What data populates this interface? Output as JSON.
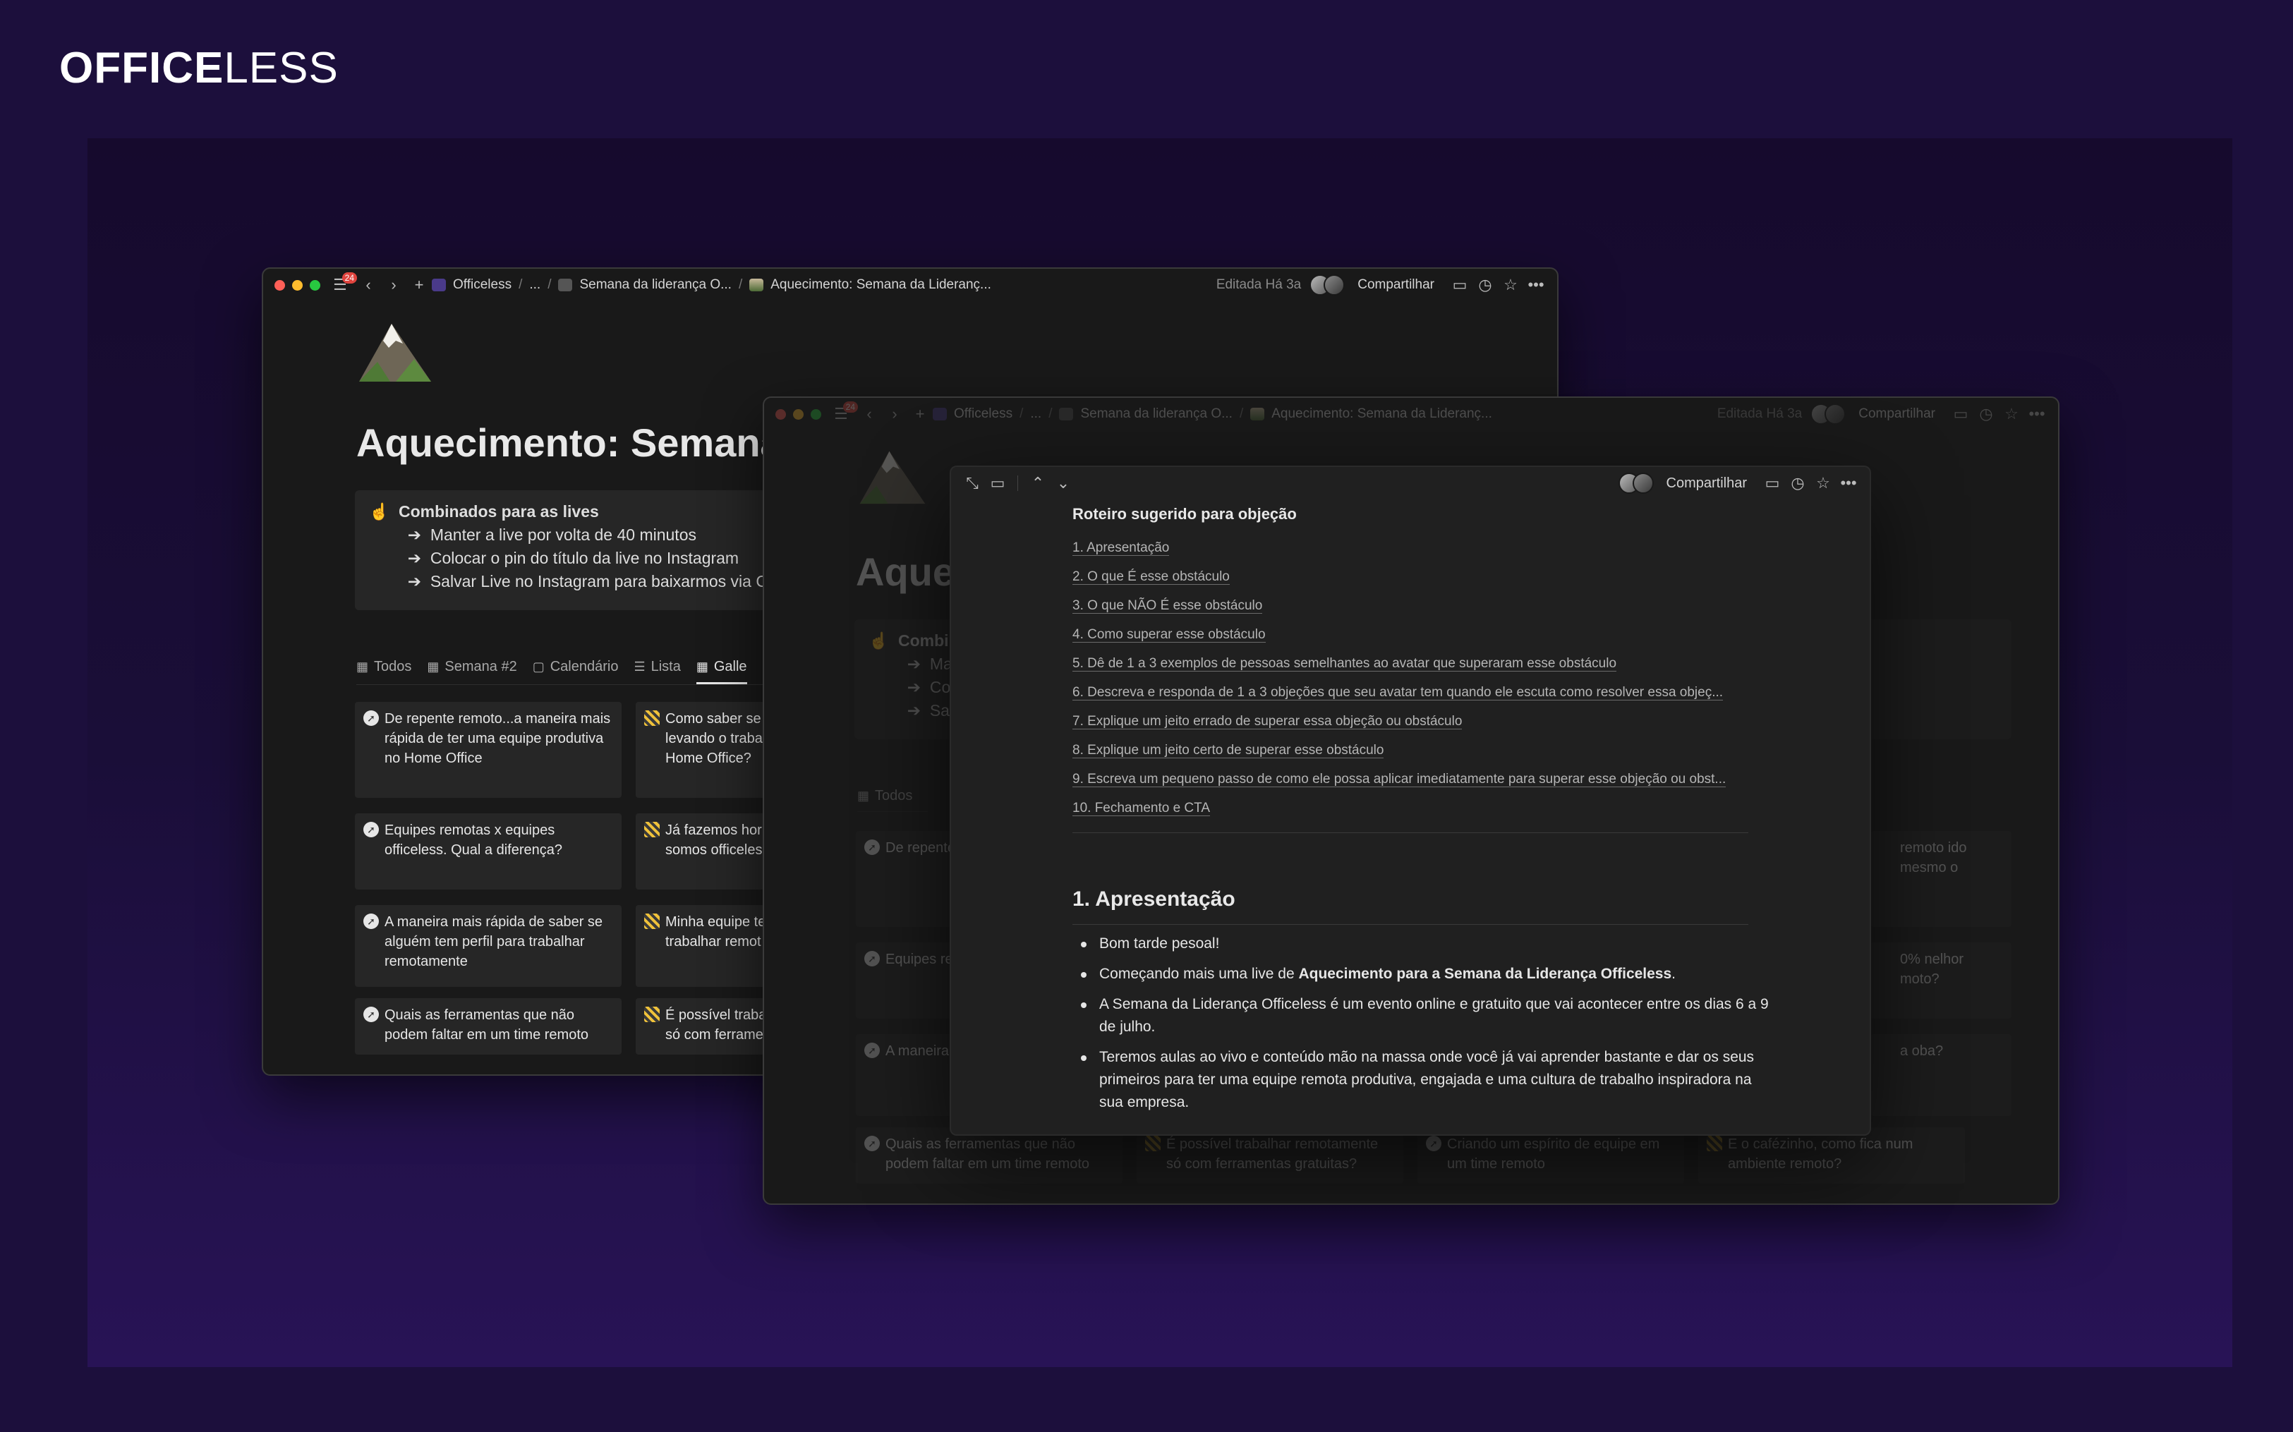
{
  "brand": {
    "logo_bold": "OFFICE",
    "logo_light": "LESS"
  },
  "back_window": {
    "badge_count": "24",
    "breadcrumb": [
      "Officeless",
      "...",
      "Semana da liderança O...",
      "Aquecimento: Semana da Lideranç..."
    ],
    "edited": "Editada Há 3a",
    "share_label": "Compartilhar",
    "title": "Aquecimento: Semana",
    "callout": {
      "heading": "Combinados para as lives",
      "items": [
        "Manter a live por volta de 40 minutos",
        "Colocar o pin do título da live no Instagram",
        "Salvar Live no Instagram para baixarmos via Chro"
      ]
    },
    "tabs": [
      "Todos",
      "Semana #2",
      "Calendário",
      "Lista",
      "Galle"
    ],
    "cards_col1": [
      "De repente remoto...a maneira mais rápida de ter uma equipe produtiva no Home Office",
      "Equipes remotas x equipes officeless. Qual a diferença?",
      "A maneira mais rápida de saber se alguém tem perfil para trabalhar remotamente",
      "Quais as ferramentas que não podem faltar em um time remoto"
    ],
    "cards_col2": [
      "Como saber se levando o traba Home Office?",
      "Já fazemos hor somos officeles",
      "Minha equipe te trabalhar remot",
      "É possível traba só com ferrame"
    ]
  },
  "front_window": {
    "badge_count": "24",
    "breadcrumb": [
      "Officeless",
      "...",
      "Semana da liderança O...",
      "Aquecimento: Semana da Lideranç..."
    ],
    "edited": "Editada Há 3a",
    "share_label": "Compartilhar",
    "title_fragment": "Aque",
    "callout_fragment": {
      "heading": "Combin",
      "items": [
        "Man",
        "Colc",
        "Salv"
      ]
    },
    "tab_fragment": "Todos",
    "right_col_fragments": [
      "remoto ido mesmo o",
      "0% nelhor moto?",
      "a oba?"
    ],
    "bottom_cards": [
      "Quais as ferramentas que não podem faltar em um time remoto",
      "É possível trabalhar remotamente só com ferramentas gratuitas?",
      "Criando um espírito de equipe em um time remoto",
      "E o cafézinho, como fica num ambiente remoto?"
    ],
    "left_card_fragments": [
      "De repente rápida de ter no Home O",
      "Equipes re officeless.",
      "A maneira alguém ter remotame"
    ]
  },
  "modal": {
    "share_label": "Compartilhar",
    "toc_title": "Roteiro sugerido para objeção",
    "toc": [
      "1. Apresentação",
      "2. O que É esse obstáculo",
      "3. O que NÃO É esse obstáculo",
      "4. Como superar esse obstáculo",
      "5. Dê de 1 a 3 exemplos de pessoas semelhantes ao avatar que superaram esse obstáculo",
      "6. Descreva e responda de 1 a 3 objeções que seu avatar tem quando ele escuta como resolver essa objeç...",
      "7. Explique um jeito errado de superar essa objeção ou obstáculo",
      "8. Explique um jeito certo de superar esse obstáculo",
      "9. Escreva um pequeno passo de como ele possa aplicar imediatamente para superar esse objeção ou obst...",
      "10. Fechamento e CTA"
    ],
    "section_heading": "1. Apresentação",
    "bullets": {
      "b1": "Bom tarde pesoal!",
      "b2_pre": "Começando mais uma live de ",
      "b2_bold": "Aquecimento para a Semana da Liderança Officeless",
      "b2_post": ".",
      "b3": "A Semana da Liderança Officeless é um evento online e gratuito que vai acontecer entre os dias 6 a 9 de julho.",
      "b4": "Teremos aulas ao vivo e conteúdo mão na massa onde você já vai aprender bastante e dar os seus primeiros para ter uma equipe remota produtiva, engajada e uma cultura de trabalho inspiradora na sua empresa."
    }
  }
}
